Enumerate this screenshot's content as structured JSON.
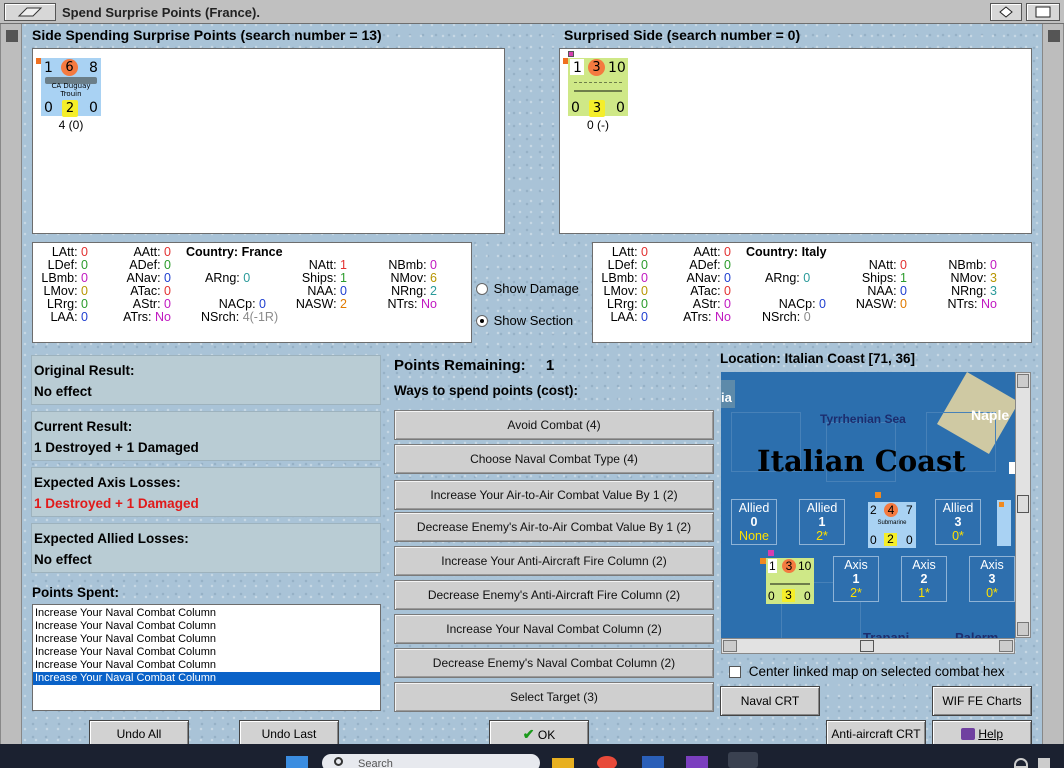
{
  "window": {
    "title": "Spend Surprise Points (France)."
  },
  "left_side": {
    "heading": "Side Spending Surprise Points (search number = 13)",
    "counter": {
      "top_left": "1",
      "top_mid": "6",
      "top_right": "8",
      "name_line1": "CA Duguay",
      "name_line2": "Trouin",
      "bot_left": "0",
      "bot_mid": "2",
      "bot_right": "0",
      "caption": "4 (0)"
    }
  },
  "right_side": {
    "heading": "Surprised Side (search number = 0)",
    "counter": {
      "top_left": "1",
      "top_mid": "3",
      "top_right": "10",
      "bot_left": "0",
      "bot_mid": "3",
      "bot_right": "0",
      "caption": "0 (-)"
    }
  },
  "left_stats": {
    "country_label": "Country:",
    "country": "France",
    "LAtt": "0",
    "LDef": "0",
    "LBmb": "0",
    "LMov": "0",
    "LRrg": "0",
    "LAA": "0",
    "AAtt": "0",
    "ADef": "0",
    "ANav": "0",
    "ATac": "0",
    "AStr": "0",
    "ATrs": "No",
    "ARng": "0",
    "NACp": "0",
    "NSrch": "4(-1R)",
    "NAtt": "1",
    "Ships": "1",
    "NAA": "0",
    "NASW": "2",
    "NBmb": "0",
    "NMov": "6",
    "NRng": "2",
    "NTrs": "No"
  },
  "right_stats": {
    "country_label": "Country:",
    "country": "Italy",
    "LAtt": "0",
    "LDef": "0",
    "LBmb": "0",
    "LMov": "0",
    "LRrg": "0",
    "LAA": "0",
    "AAtt": "0",
    "ADef": "0",
    "ANav": "0",
    "ATac": "0",
    "AStr": "0",
    "ATrs": "No",
    "ARng": "0",
    "NACp": "0",
    "NSrch": "0",
    "NAtt": "0",
    "Ships": "1",
    "NAA": "0",
    "NASW": "0",
    "NBmb": "0",
    "NMov": "3",
    "NRng": "3",
    "NTrs": "No"
  },
  "labels": {
    "LAtt": "LAtt:",
    "LDef": "LDef:",
    "LBmb": "LBmb:",
    "LMov": "LMov:",
    "LRrg": "LRrg:",
    "LAA": "LAA:",
    "AAtt": "AAtt:",
    "ADef": "ADef:",
    "ANav": "ANav:",
    "ATac": "ATac:",
    "AStr": "AStr:",
    "ATrs": "ATrs:",
    "ARng": "ARng:",
    "NACp": "NACp:",
    "NSrch": "NSrch:",
    "NAtt": "NAtt:",
    "Ships": "Ships:",
    "NAA": "NAA:",
    "NASW": "NASW:",
    "NBmb": "NBmb:",
    "NMov": "NMov:",
    "NRng": "NRng:",
    "NTrs": "NTrs:"
  },
  "options": {
    "show_damage": "Show Damage",
    "show_section": "Show Section"
  },
  "results": {
    "original_label": "Original Result:",
    "original_value": "No effect",
    "current_label": "Current Result:",
    "current_value": "1 Destroyed + 1 Damaged",
    "axis_label": "Expected Axis Losses:",
    "axis_value": "1 Destroyed + 1 Damaged",
    "allied_label": "Expected Allied Losses:",
    "allied_value": "No effect"
  },
  "points_spent": {
    "label": "Points Spent:",
    "items": [
      "Increase Your Naval Combat Column",
      "Increase Your Naval Combat Column",
      "Increase Your Naval Combat Column",
      "Increase Your Naval Combat Column",
      "Increase Your Naval Combat Column",
      "Increase Your Naval Combat Column"
    ]
  },
  "spend": {
    "remaining_label": "Points Remaining:",
    "remaining_value": "1",
    "ways_label": "Ways to spend points (cost):",
    "buttons": [
      "Avoid Combat (4)",
      "Choose Naval Combat Type (4)",
      "Increase Your Air-to-Air Combat Value By 1 (2)",
      "Decrease Enemy's Air-to-Air Combat Value By 1 (2)",
      "Increase Your Anti-Aircraft Fire Column (2)",
      "Decrease Enemy's Anti-Aircraft Fire Column (2)",
      "Increase Your Naval Combat Column (2)",
      "Decrease Enemy's Naval Combat Column (2)",
      "Select Target (3)"
    ]
  },
  "map": {
    "location": "Location: Italian Coast [71, 36]",
    "sea": "Tyrrhenian Sea",
    "title": "Italian Coast",
    "city1": "Naple",
    "city2": "Trapani",
    "city3": "Palerm",
    "frag": "ia",
    "sub_name": "Submarine",
    "allied": [
      {
        "label": "Allied",
        "num": "0",
        "val": "None"
      },
      {
        "label": "Allied",
        "num": "1",
        "val": "2*"
      },
      {
        "label": "Allied",
        "num": "3",
        "val": "0*"
      }
    ],
    "axis": [
      {
        "label": "Axis",
        "num": "1",
        "val": "2*"
      },
      {
        "label": "Axis",
        "num": "2",
        "val": "1*"
      },
      {
        "label": "Axis",
        "num": "3",
        "val": "0*"
      }
    ],
    "sub_counter": {
      "a": "2",
      "b": "4",
      "c": "7",
      "d": "0",
      "e": "2",
      "f": "0"
    },
    "center_label": "Center linked map on selected combat hex"
  },
  "bottom": {
    "undo_all": "Undo All",
    "undo_last": "Undo Last",
    "ok": "OK",
    "naval_crt": "Naval CRT",
    "aa_crt": "Anti-aircraft CRT",
    "wif_charts": "WIF FE Charts",
    "help": "Help"
  },
  "taskbar": {
    "search": "Search"
  }
}
